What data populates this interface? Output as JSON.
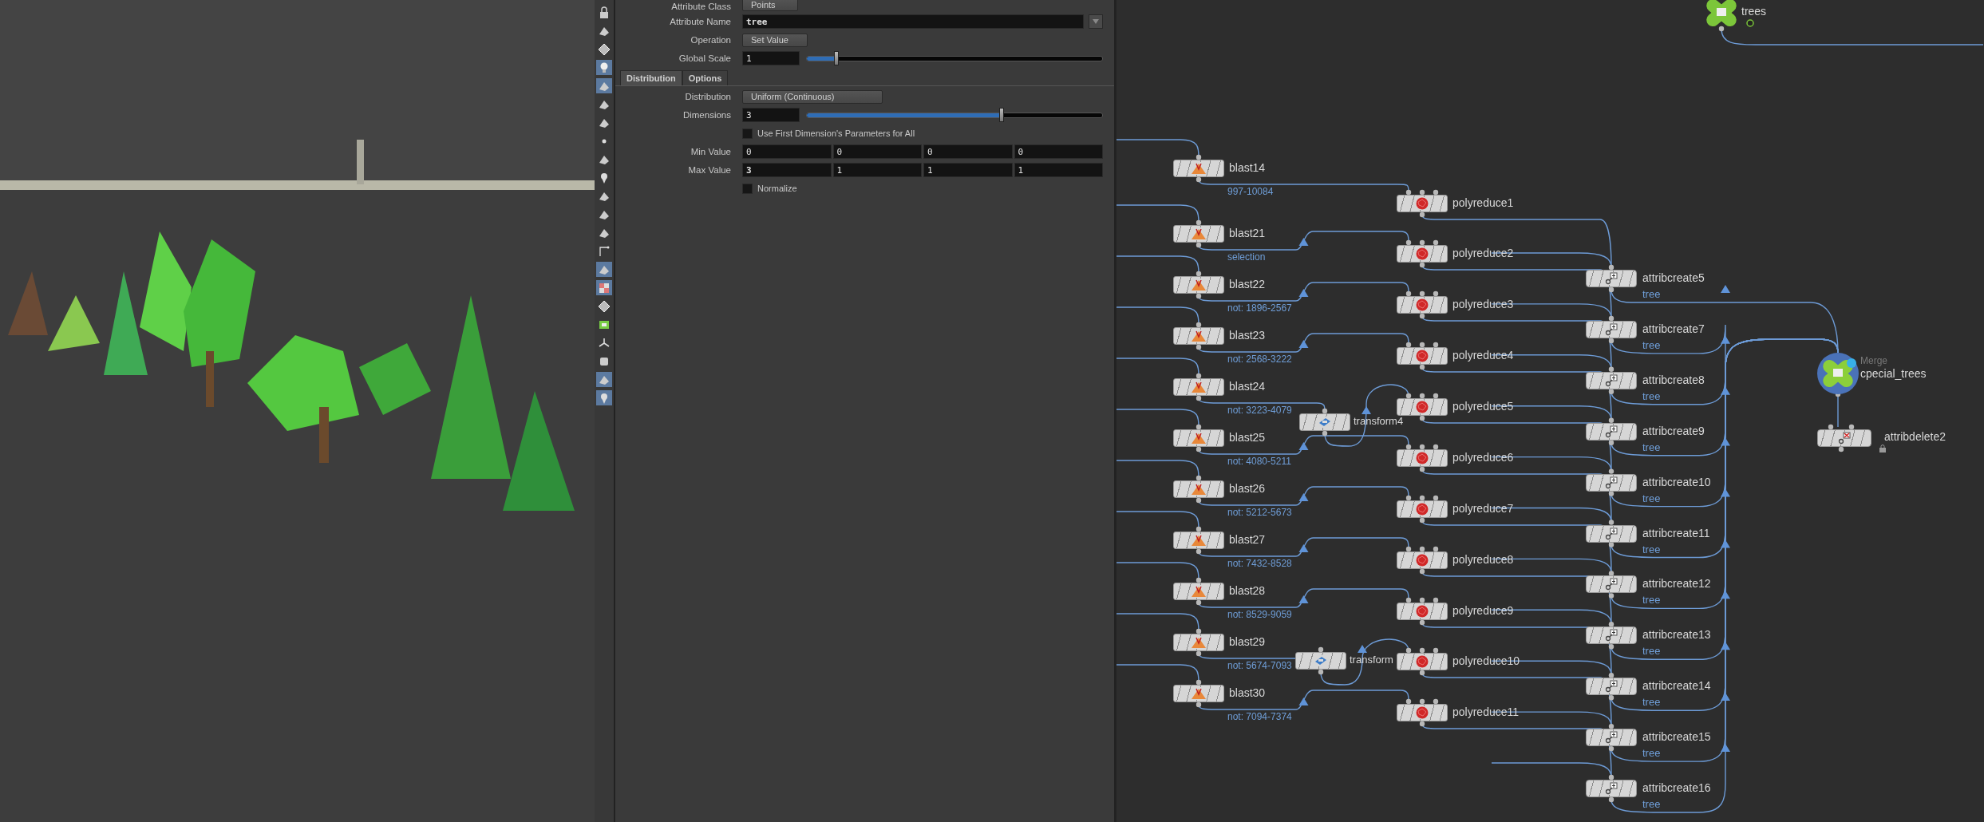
{
  "viewport_toolbar": [
    {
      "selected": false
    },
    {
      "selected": false
    },
    {
      "selected": false
    },
    {
      "selected": true
    },
    {
      "selected": true
    },
    {
      "selected": false
    },
    {
      "selected": false
    },
    {
      "selected": false
    },
    {
      "selected": false
    },
    {
      "selected": false
    },
    {
      "selected": false
    },
    {
      "selected": false
    },
    {
      "selected": false
    },
    {
      "selected": false
    },
    {
      "selected": true
    },
    {
      "selected": true
    },
    {
      "selected": false
    },
    {
      "selected": false
    },
    {
      "selected": false
    },
    {
      "selected": false
    },
    {
      "selected": true
    },
    {
      "selected": true
    }
  ],
  "parameter_editor": {
    "attribute_class": {
      "label": "Attribute Class",
      "value": "Points"
    },
    "attribute_name": {
      "label": "Attribute Name",
      "value": "tree",
      "modified": true
    },
    "operation": {
      "label": "Operation",
      "value": "Set Value"
    },
    "global_scale": {
      "label": "Global Scale",
      "value": "1",
      "modified": false,
      "level": 0.1
    },
    "tabs": [
      {
        "label": "Distribution",
        "selected": true
      },
      {
        "label": "Options",
        "selected": false
      }
    ],
    "distribution": {
      "label": "Distribution",
      "value": "Uniform (Continuous)"
    },
    "dimensions": {
      "label": "Dimensions",
      "value": "3",
      "modified": false,
      "level": 0.66
    },
    "use_first": {
      "label": "Use First Dimension's Parameters for All",
      "checked": false
    },
    "min_value": {
      "label": "Min Value",
      "values": [
        {
          "value": "0",
          "modified": false
        },
        {
          "value": "0",
          "modified": false
        },
        {
          "value": "0",
          "modified": false
        },
        {
          "value": "0",
          "modified": false
        }
      ]
    },
    "max_value": {
      "label": "Max Value",
      "values": [
        {
          "value": "3",
          "modified": true
        },
        {
          "value": "1",
          "modified": false
        },
        {
          "value": "1",
          "modified": false
        },
        {
          "value": "1",
          "modified": false
        }
      ]
    },
    "normalize": {
      "label": "Normalize",
      "checked": false
    }
  },
  "network": {
    "merge_top": {
      "name": "trees"
    },
    "blast_nodes": [
      {
        "name": "blast14",
        "comment": "997-10084"
      },
      {
        "name": "blast21",
        "comment": "selection"
      },
      {
        "name": "blast22",
        "comment": "not: 1896-2567"
      },
      {
        "name": "blast23",
        "comment": "not: 2568-3222"
      },
      {
        "name": "blast24",
        "comment": "not: 3223-4079"
      },
      {
        "name": "blast25",
        "comment": "not: 4080-5211"
      },
      {
        "name": "blast26",
        "comment": "not: 5212-5673"
      },
      {
        "name": "blast27",
        "comment": "not: 7432-8528"
      },
      {
        "name": "blast28",
        "comment": "not: 8529-9059"
      },
      {
        "name": "blast29",
        "comment": "not: 5674-7093"
      },
      {
        "name": "blast30",
        "comment": "not: 7094-7374"
      }
    ],
    "transform_nodes": [
      {
        "name": "transform4"
      },
      {
        "name": "transform"
      }
    ],
    "polyreduce_nodes": [
      {
        "name": "polyreduce1"
      },
      {
        "name": "polyreduce2"
      },
      {
        "name": "polyreduce3"
      },
      {
        "name": "polyreduce4"
      },
      {
        "name": "polyreduce5"
      },
      {
        "name": "polyreduce6"
      },
      {
        "name": "polyreduce7"
      },
      {
        "name": "polyreduce8"
      },
      {
        "name": "polyreduce9"
      },
      {
        "name": "polyreduce10"
      },
      {
        "name": "polyreduce11"
      }
    ],
    "attribcreate_nodes": [
      {
        "name": "attribcreate5",
        "comment": "tree"
      },
      {
        "name": "attribcreate7",
        "comment": "tree"
      },
      {
        "name": "attribcreate8",
        "comment": "tree"
      },
      {
        "name": "attribcreate9",
        "comment": "tree"
      },
      {
        "name": "attribcreate10",
        "comment": "tree"
      },
      {
        "name": "attribcreate11",
        "comment": "tree"
      },
      {
        "name": "attribcreate12",
        "comment": "tree"
      },
      {
        "name": "attribcreate13",
        "comment": "tree"
      },
      {
        "name": "attribcreate14",
        "comment": "tree"
      },
      {
        "name": "attribcreate15",
        "comment": "tree"
      },
      {
        "name": "attribcreate16",
        "comment": "tree"
      }
    ],
    "merge_node": {
      "type_label": "Merge",
      "name": "cpecial_trees"
    },
    "attribdelete_node": {
      "name": "attribdelete2"
    }
  }
}
